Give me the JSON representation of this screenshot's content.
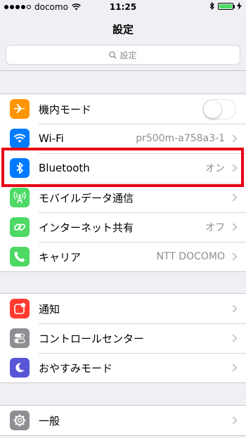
{
  "status_bar": {
    "carrier": "docomo",
    "time": "11:25"
  },
  "nav": {
    "title": "設定"
  },
  "search": {
    "placeholder": "設定"
  },
  "colors": {
    "airplane": "#ff9500",
    "wifi": "#007aff",
    "bluetooth": "#007aff",
    "cellular": "#4cd964",
    "hotspot": "#4cd964",
    "carrier": "#4cd964",
    "notifications": "#ff3b30",
    "control_center": "#8e8e93",
    "dnd": "#5856d6",
    "general": "#8e8e93",
    "highlight": "#e60012"
  },
  "section1": {
    "airplane": {
      "label": "機内モード",
      "icon": "airplane-icon",
      "toggle": false
    },
    "wifi": {
      "label": "Wi-Fi",
      "value": "pr500m-a758a3-1",
      "icon": "wifi-icon"
    },
    "bluetooth": {
      "label": "Bluetooth",
      "value": "オン",
      "icon": "bluetooth-icon"
    },
    "cellular": {
      "label": "モバイルデータ通信",
      "icon": "antenna-icon"
    },
    "hotspot": {
      "label": "インターネット共有",
      "value": "オフ",
      "icon": "link-icon"
    },
    "carrier": {
      "label": "キャリア",
      "value": "NTT DOCOMO",
      "icon": "phone-icon"
    }
  },
  "section2": {
    "notifications": {
      "label": "通知",
      "icon": "notifications-icon"
    },
    "control_center": {
      "label": "コントロールセンター",
      "icon": "toggles-icon"
    },
    "dnd": {
      "label": "おやすみモード",
      "icon": "moon-icon"
    }
  },
  "section3": {
    "general": {
      "label": "一般",
      "icon": "gear-icon"
    }
  }
}
